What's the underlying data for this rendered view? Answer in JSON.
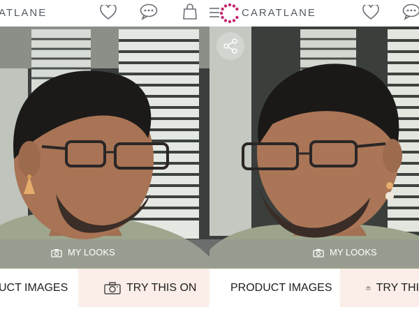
{
  "left_screen": {
    "brand_text": "ATLANE",
    "looks_label": "MY LOOKS",
    "product_images_label": "UCT IMAGES",
    "try_on_label": "TRY THIS ON"
  },
  "right_screen": {
    "brand_text": "CARATLANE",
    "looks_label": "MY LOOKS",
    "product_images_label": "PRODUCT IMAGES",
    "try_on_label": "TRY THI"
  },
  "colors": {
    "brand_pink": "#c4266f",
    "try_on_bg": "#fbeee9",
    "icon_gray": "#6b6f76"
  },
  "icons": [
    "wishlist-heart-icon",
    "chat-icon",
    "shopping-bag-icon",
    "menu-icon",
    "caratlane-logo",
    "share-icon",
    "camera-icon"
  ]
}
